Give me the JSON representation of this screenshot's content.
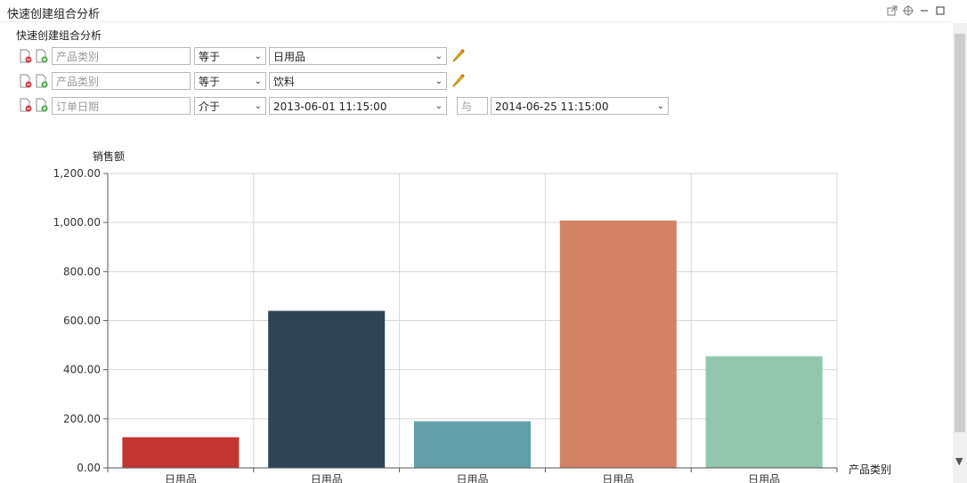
{
  "window": {
    "title": "快速创建组合分析"
  },
  "panel": {
    "subtitle": "快速创建组合分析"
  },
  "filters": [
    {
      "field": "产品类别",
      "operator": "等于",
      "value": "日用品"
    },
    {
      "field": "产品类别",
      "operator": "等于",
      "value": "饮料"
    },
    {
      "field": "订单日期",
      "operator": "介于",
      "value": "2013-06-01 11:15:00",
      "connector": "与",
      "value2": "2014-06-25 11:15:00"
    }
  ],
  "icons": {
    "remove": "remove-condition-icon",
    "add": "add-condition-icon",
    "edit": "pencil-icon",
    "export": "external-link-icon",
    "target": "crosshair-icon",
    "minimize": "minimize-icon",
    "maximize": "maximize-icon"
  },
  "chart_data": {
    "type": "bar",
    "ylabel": "销售额",
    "xlabel": "产品类别",
    "categories": [
      "日用品",
      "日用品",
      "日用品",
      "日用品",
      "日用品"
    ],
    "values": [
      125,
      640,
      190,
      1008,
      455
    ],
    "colors": [
      "#c23531",
      "#2f4554",
      "#61a0a8",
      "#d48265",
      "#91c7ae"
    ],
    "ylim": [
      0,
      1200
    ],
    "yticks": [
      "0.00",
      "200.00",
      "400.00",
      "600.00",
      "800.00",
      "1,000.00",
      "1,200.00"
    ],
    "grid": true
  }
}
